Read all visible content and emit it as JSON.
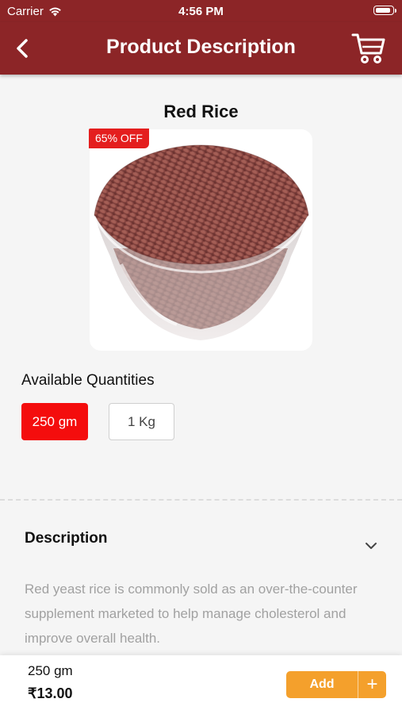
{
  "status_bar": {
    "carrier": "Carrier",
    "time": "4:56 PM"
  },
  "header": {
    "title": "Product Description",
    "back_icon": "chevron-left-icon",
    "cart_icon": "shopping-cart-icon"
  },
  "product": {
    "name": "Red Rice",
    "discount_badge": "65% OFF",
    "image": "red-rice-bowl"
  },
  "quantities": {
    "title": "Available Quantities",
    "options": [
      "250 gm",
      "1 Kg"
    ],
    "selected": "250 gm"
  },
  "description": {
    "title": "Description",
    "text": "Red yeast rice is commonly sold as an over-the-counter supplement marketed to help manage cholesterol and improve overall health."
  },
  "footer": {
    "selected_quantity": "250 gm",
    "price": "₹13.00",
    "add_label": "Add",
    "plus_label": "+"
  },
  "colors": {
    "brand": "#8c2527",
    "selected_option": "#f40d0d",
    "badge": "#e41e1e",
    "add_button": "#f4a02c"
  }
}
